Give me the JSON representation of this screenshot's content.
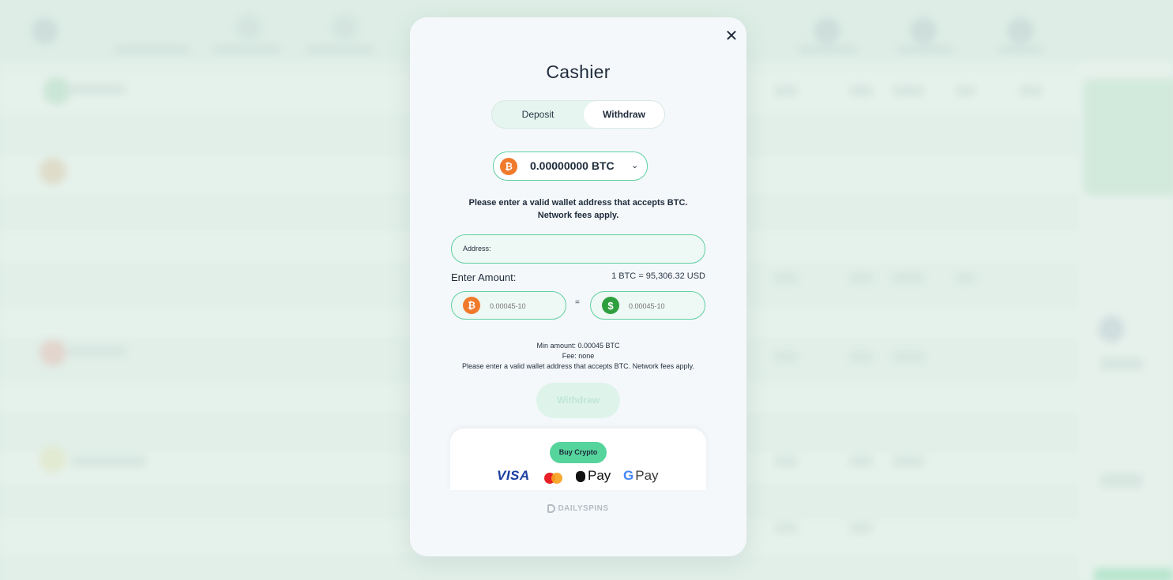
{
  "modal": {
    "title": "Cashier",
    "close_symbol": "✕"
  },
  "tabs": [
    {
      "label": "Deposit",
      "active": false
    },
    {
      "label": "Withdraw",
      "active": true
    }
  ],
  "currency": {
    "icon": "bitcoin-icon",
    "symbol": "₿",
    "balance": "0.00000000 BTC",
    "chevron": "⌄"
  },
  "notice": {
    "line1": "Please enter a valid wallet address that accepts BTC.",
    "line2": "Network fees apply."
  },
  "address": {
    "label": "Address:",
    "value": ""
  },
  "amount": {
    "label": "Enter Amount:",
    "rate": "1 BTC = 95,306.32 USD",
    "btc_placeholder": "0.00045-10",
    "usd_placeholder": "0.00045-10",
    "usd_symbol": "$",
    "equals": "="
  },
  "info": {
    "min_amount": "Min amount: 0.00045 BTC",
    "fee": "Fee: none",
    "note": "Please enter a valid wallet address that accepts BTC. Network fees apply."
  },
  "withdraw_button": "Withdraw",
  "payment": {
    "buy_crypto": "Buy Crypto",
    "visa": "VISA",
    "apple_pay": "Pay",
    "google_g": "G",
    "google_pay": "Pay"
  },
  "brand": "DAILYSPINS",
  "colors": {
    "accent": "#5fcfa1",
    "buy_button": "#55d49c",
    "btc": "#f07a2c",
    "usd": "#2e9f3f",
    "text": "#1e2b3a"
  }
}
